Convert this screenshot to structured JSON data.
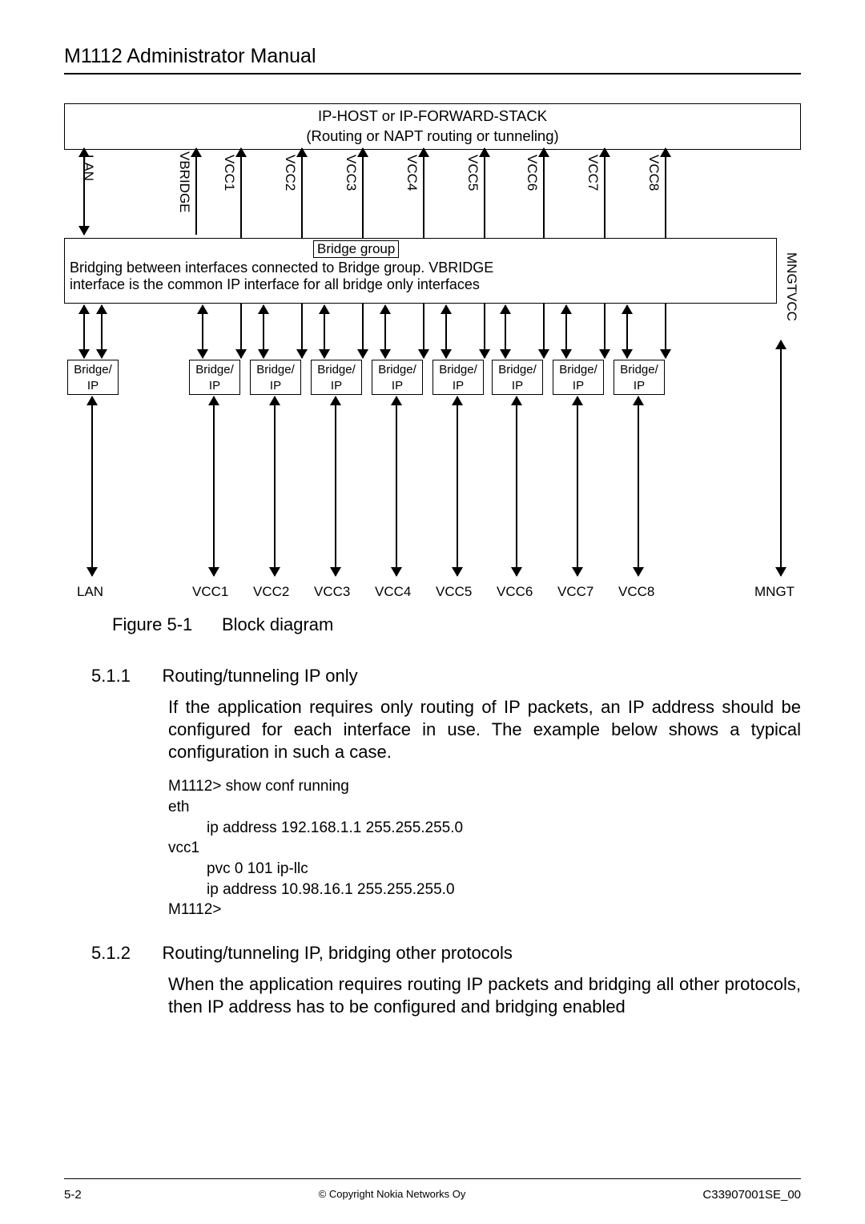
{
  "header": "M1112 Administrator Manual",
  "diagram": {
    "top_line1": "IP-HOST or IP-FORWARD-STACK",
    "top_line2": "(Routing or NAPT routing or tunneling)",
    "cols": [
      "LAN",
      "VBRIDGE",
      "VCC1",
      "VCC2",
      "VCC3",
      "VCC4",
      "VCC5",
      "VCC6",
      "VCC7",
      "VCC8"
    ],
    "bridge_title": "Bridge group",
    "bridge_line1": "Bridging between interfaces connected to Bridge group. VBRIDGE",
    "bridge_line2": "interface is the common IP interface for all bridge only interfaces",
    "right_label": "MNGTVCC",
    "ip_box": "Bridge/\nIP",
    "bottom": [
      "LAN",
      "VCC1",
      "VCC2",
      "VCC3",
      "VCC4",
      "VCC5",
      "VCC6",
      "VCC7",
      "VCC8",
      "MNGT"
    ]
  },
  "figcap": {
    "num": "Figure 5-1",
    "txt": "Block diagram"
  },
  "sec1": {
    "num": "5.1.1",
    "title": "Routing/tunneling IP only",
    "para": "If the application requires only routing of IP packets, an IP address should be configured for each interface in use. The example below shows a typical configuration in such a case.",
    "code": [
      "M1112> show conf running",
      "eth",
      "    ip address 192.168.1.1 255.255.255.0",
      "vcc1",
      "    pvc 0 101 ip-llc",
      "    ip address 10.98.16.1 255.255.255.0",
      "M1112>"
    ]
  },
  "sec2": {
    "num": "5.1.2",
    "title": "Routing/tunneling IP, bridging other protocols",
    "para": "When the application requires routing IP packets and bridging all other protocols, then IP address has to be configured and bridging enabled"
  },
  "footer": {
    "left": "5-2",
    "mid": "© Copyright Nokia Networks Oy",
    "right": "C33907001SE_00"
  }
}
